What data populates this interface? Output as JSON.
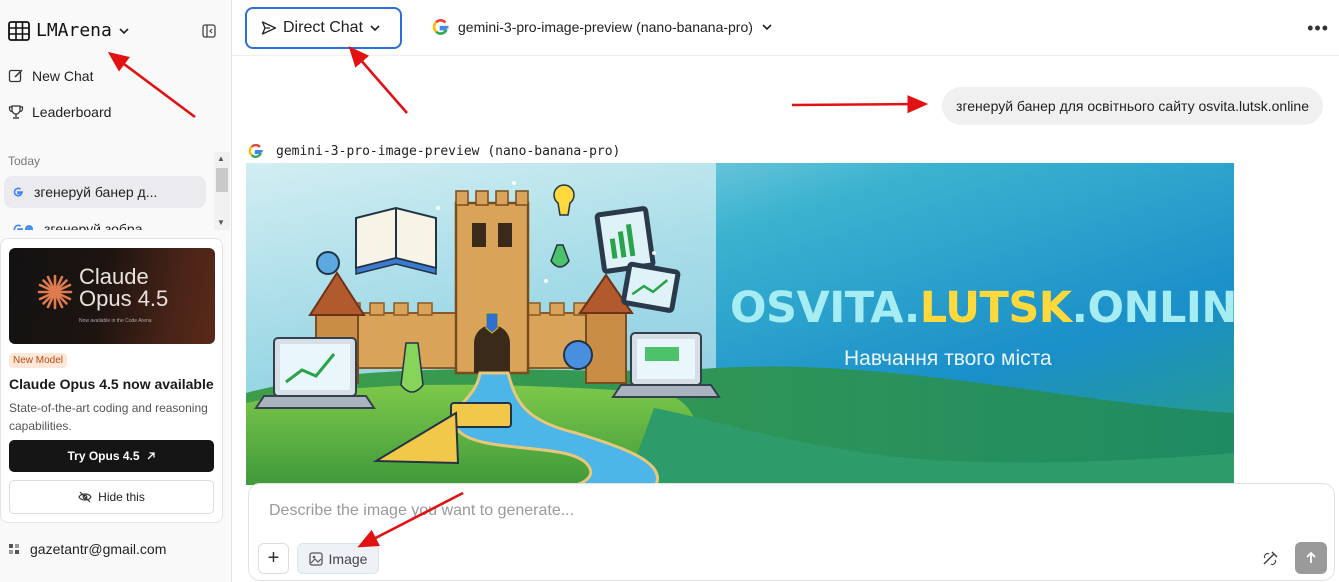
{
  "sidebar": {
    "brand": "LMArena",
    "nav": [
      {
        "label": "New Chat",
        "icon": "edit-icon"
      },
      {
        "label": "Leaderboard",
        "icon": "trophy-icon"
      }
    ],
    "section_today": "Today",
    "history": [
      {
        "label": "згенеруй банер д...",
        "icon": "google-icon",
        "active": true
      },
      {
        "label": "згенеруй зобра",
        "icon": "google-icon",
        "active": false
      }
    ],
    "promo": {
      "image_title_line1": "Claude",
      "image_title_line2": "Opus 4.5",
      "image_subtitle": "Now available in the Code Arena",
      "badge": "New Model",
      "title": "Claude Opus 4.5 now available",
      "description": "State-of-the-art coding and reasoning capabilities.",
      "cta": "Try Opus 4.5",
      "cta_icon": "arrow-up-right-icon",
      "dismiss": "Hide this",
      "dismiss_icon": "eye-off-icon"
    },
    "account_email": "gazetantr@gmail.com"
  },
  "topbar": {
    "mode": "Direct Chat",
    "model": "gemini-3-pro-image-preview (nano-banana-pro)"
  },
  "chat": {
    "user_message": "згенеруй банер для освітнього сайту osvita.lutsk.online",
    "response_model": "gemini-3-pro-image-preview (nano-banana-pro)",
    "banner": {
      "title_part1": "OSVITA.",
      "title_part2": "LUTSK",
      "title_part3": ".ONLINE",
      "subtitle": "Навчання твого міста"
    }
  },
  "composer": {
    "placeholder": "Describe the image you want to generate...",
    "plus": "+",
    "image_chip": "Image"
  },
  "colors": {
    "accent_blue": "#2f6fdc",
    "annotation_red": "#e31212",
    "banner_title_cyan": "#a6ecf3",
    "banner_title_yellow": "#ffd93b"
  }
}
